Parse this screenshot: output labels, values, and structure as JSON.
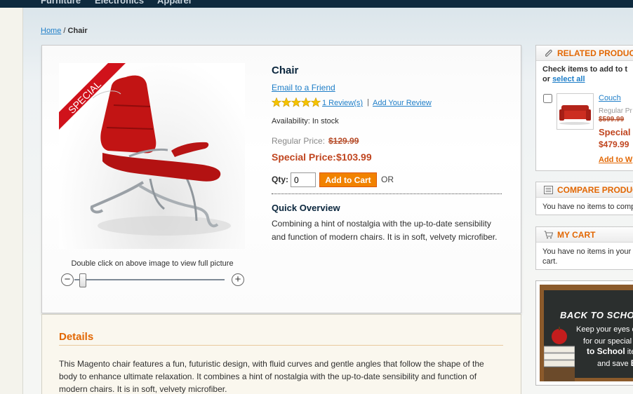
{
  "topnav": {
    "items": [
      "Furniture",
      "Electronics",
      "Apparel"
    ]
  },
  "breadcrumb": {
    "home": "Home",
    "sep": "/",
    "current": "Chair"
  },
  "product": {
    "special_ribbon": "SPECIAL",
    "name": "Chair",
    "email_friend": "Email to a Friend",
    "rating_stars": 5,
    "reviews_link": "1 Review(s)",
    "review_sep": "|",
    "add_review": "Add Your Review",
    "availability": "Availability: In stock",
    "regular_label": "Regular Price:",
    "regular_price": "$129.99",
    "special_label": "Special Price:",
    "special_price": "$103.99",
    "qty_label": "Qty:",
    "qty_value": "0",
    "add_to_cart": "Add to Cart",
    "or_text": "OR",
    "quick_overview_title": "Quick Overview",
    "quick_overview_text": "Combining a hint of nostalgia with the up-to-date sensibility and function of modern chairs. It is in soft, velvety microfiber.",
    "image_hint": "Double click on above image to view  full picture",
    "zoom_level": 0.02
  },
  "details": {
    "title": "Details",
    "text": "This Magento chair features a fun, futuristic design, with fluid curves and gentle angles that follow the shape of the body to enhance ultimate relaxation. It combines a hint of nostalgia with the up-to-date sensibility and function of modern chairs. It is in soft, velvety microfiber."
  },
  "sidebar": {
    "related": {
      "title": "RELATED PRODUCTS",
      "check_text": "Check items to add to t",
      "or_text": "or",
      "select_all": "select all",
      "item": {
        "name": "Couch",
        "regular_label": "Regular Pr",
        "regular_price": "$599.99",
        "special_label": "Special",
        "special_price": "$479.99",
        "add_to_wishlist": "Add to W"
      }
    },
    "compare": {
      "title": "COMPARE PRODUC",
      "text": "You have no items to comp"
    },
    "cart": {
      "title": "MY CART",
      "text_line1": "You have no items in your s",
      "text_line2": "cart."
    },
    "promo": {
      "heading": "BACK TO SCHO",
      "line1": "Keep your eyes o",
      "line2a": "for our special ",
      "line2b": "B",
      "line3": "to School",
      "line3b": " ite",
      "line4a": "and save ",
      "line4b": "B"
    }
  },
  "colors": {
    "accent_orange": "#f18200",
    "link_blue": "#1e7ec8",
    "price_red": "#c0451f",
    "nav_dark": "#0e2a3e"
  }
}
